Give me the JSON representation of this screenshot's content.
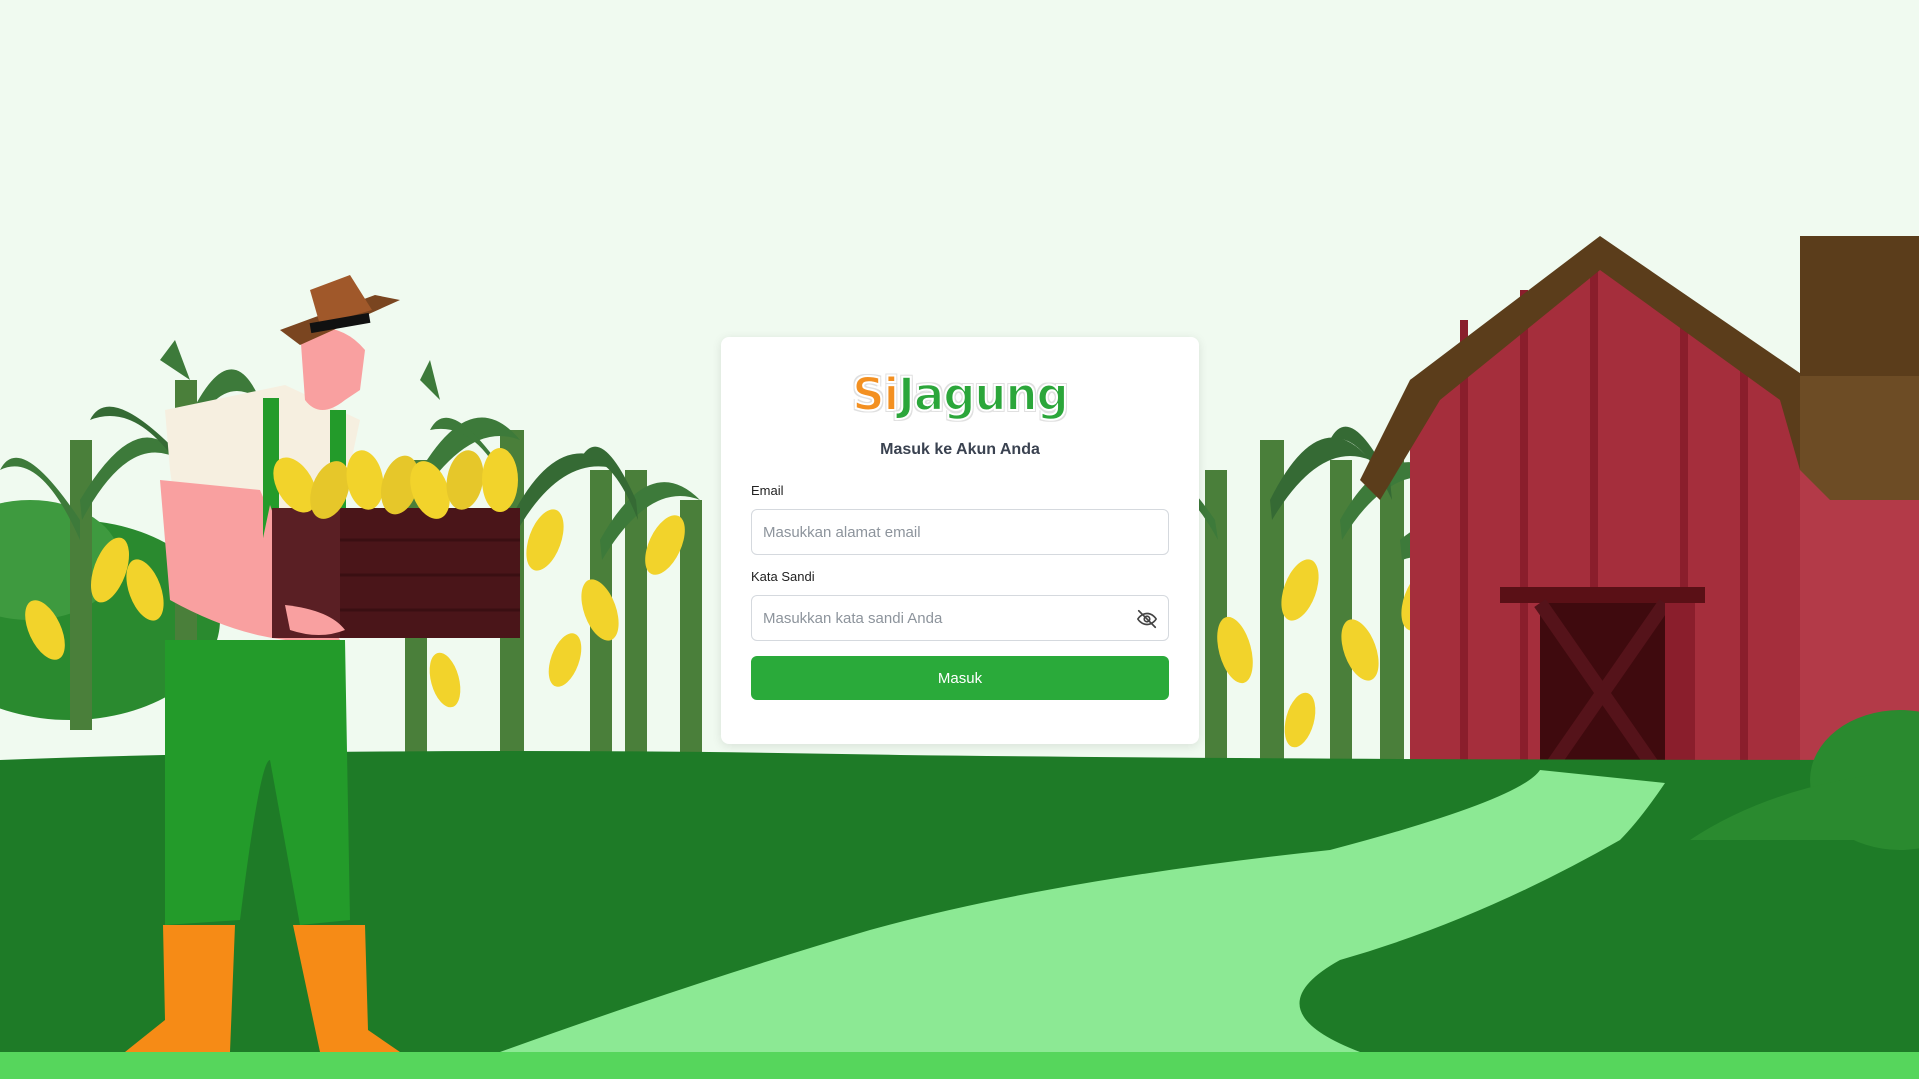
{
  "brand": {
    "logo_si": "Si",
    "logo_jagung": "Jagung"
  },
  "login": {
    "heading": "Masuk ke Akun Anda",
    "email_label": "Email",
    "email_placeholder": "Masukkan alamat email",
    "password_label": "Kata Sandi",
    "password_placeholder": "Masukkan kata sandi Anda",
    "submit_label": "Masuk",
    "toggle_icon": "eye-off-icon"
  },
  "colors": {
    "primary_green": "#2aaa3a",
    "logo_orange": "#f39021",
    "background": "#f0faf0",
    "field_green": "#1e7b27",
    "path_green": "#8ce994",
    "barn_red": "#a52e3c"
  }
}
